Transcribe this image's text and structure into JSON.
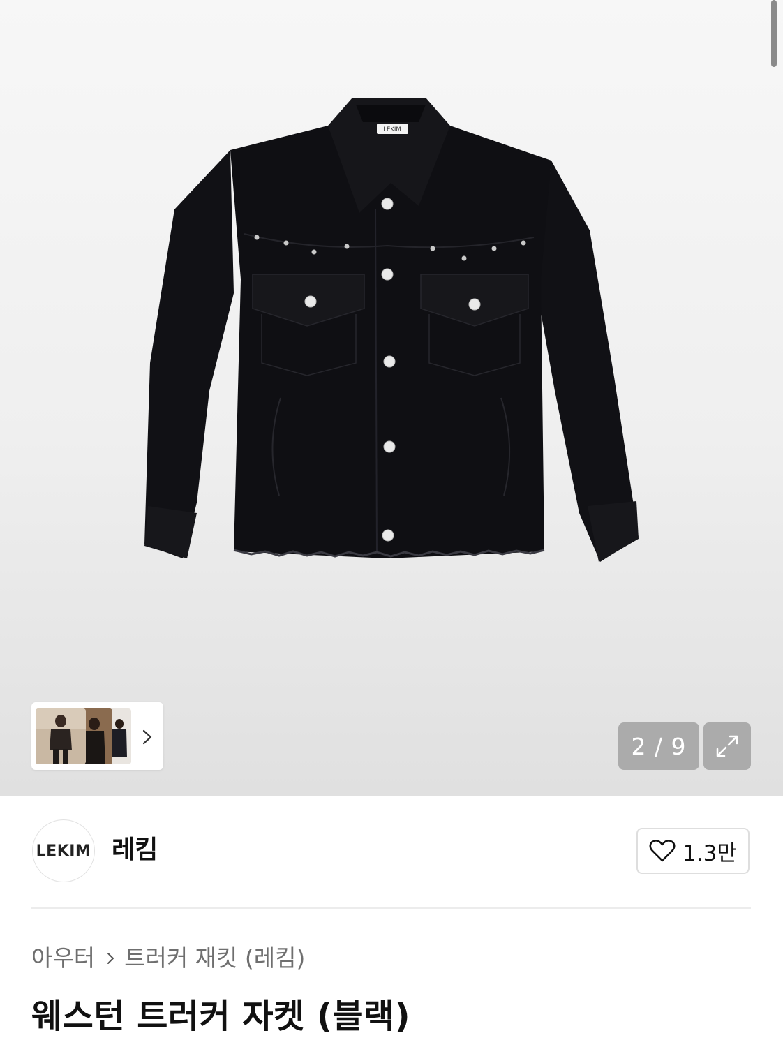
{
  "gallery": {
    "current": "2",
    "total": "9",
    "counter_text": "2 / 9",
    "jacket_label": "LEKIM",
    "thumbnail_icons": [
      "model-photo-thumbnail",
      "model-photo-thumbnail",
      "model-photo-thumbnail"
    ]
  },
  "brand": {
    "logo_text": "LEKIM",
    "name": "레킴",
    "like_count": "1.3만"
  },
  "breadcrumb": {
    "category": "아우터",
    "subcategory": "트러커 재킷 (레킴)"
  },
  "product": {
    "title": "웨스턴 트러커 자켓 (블랙)"
  },
  "colors": {
    "background_top": "#f7f7f7",
    "background_bottom": "#e0e0e0",
    "jacket": "#111115",
    "overlay": "#9b9b9b"
  }
}
